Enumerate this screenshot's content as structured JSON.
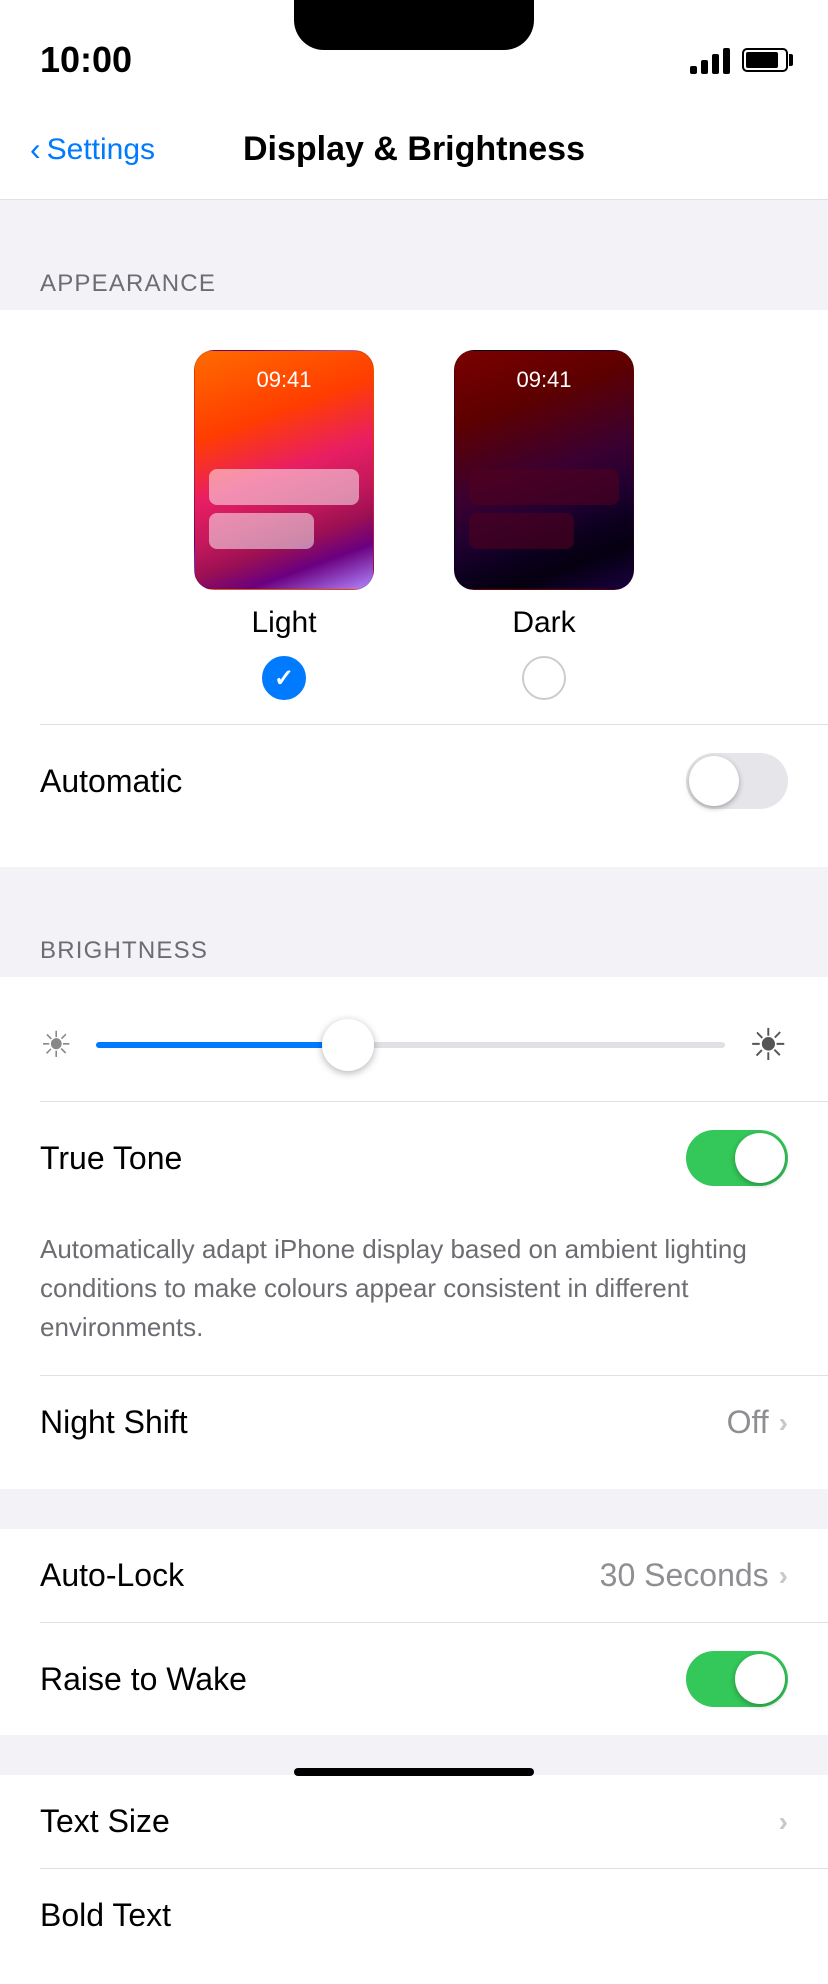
{
  "statusBar": {
    "time": "10:00",
    "signalBars": [
      8,
      14,
      20,
      26
    ],
    "batteryLevel": 85
  },
  "navBar": {
    "backLabel": "Settings",
    "title": "Display & Brightness"
  },
  "appearance": {
    "sectionHeader": "APPEARANCE",
    "light": {
      "label": "Light",
      "previewTime": "09:41",
      "selected": true
    },
    "dark": {
      "label": "Dark",
      "previewTime": "09:41",
      "selected": false
    },
    "automatic": {
      "label": "Automatic",
      "enabled": false
    }
  },
  "brightness": {
    "sectionHeader": "BRIGHTNESS",
    "sliderPercent": 40,
    "trueTone": {
      "label": "True Tone",
      "enabled": true
    },
    "description": "Automatically adapt iPhone display based on ambient lighting conditions to make colours appear consistent in different environments."
  },
  "nightShift": {
    "label": "Night Shift",
    "value": "Off"
  },
  "autoLock": {
    "label": "Auto-Lock",
    "value": "30 Seconds"
  },
  "raiseToWake": {
    "label": "Raise to Wake",
    "enabled": true
  },
  "textSize": {
    "label": "Text Size"
  },
  "boldText": {
    "label": "Bold Text"
  }
}
